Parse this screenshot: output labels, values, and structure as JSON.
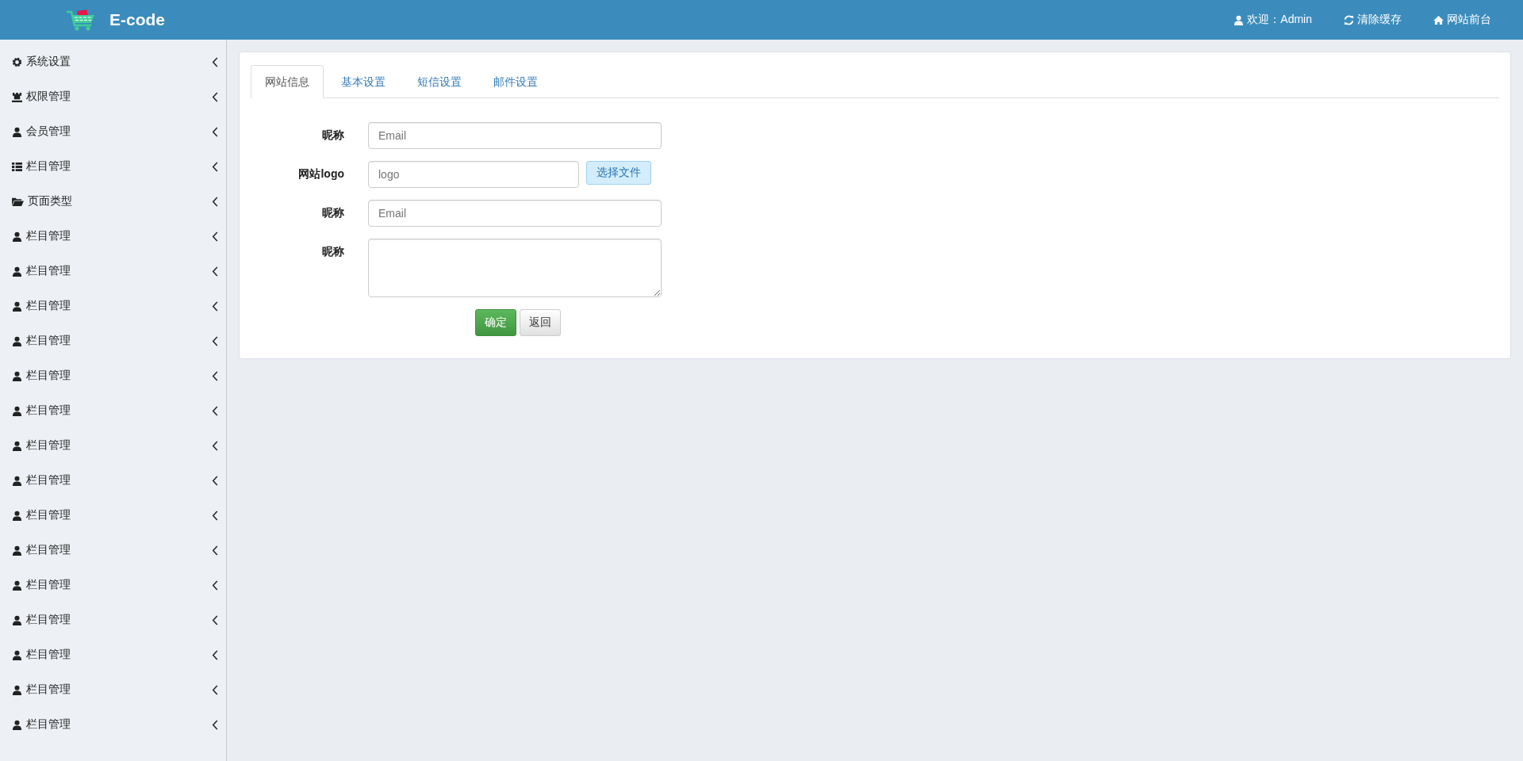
{
  "header": {
    "brand": "E-code",
    "links": [
      {
        "kind": "user",
        "label": "欢迎：Admin"
      },
      {
        "kind": "refresh",
        "label": "清除缓存"
      },
      {
        "kind": "home",
        "label": "网站前台"
      }
    ]
  },
  "sidebar": {
    "items": [
      {
        "kind": "gear",
        "label": "系统设置"
      },
      {
        "kind": "rook",
        "label": "权限管理"
      },
      {
        "kind": "user",
        "label": "会员管理"
      },
      {
        "kind": "list",
        "label": "栏目管理"
      },
      {
        "kind": "folder",
        "label": "页面类型"
      },
      {
        "kind": "user",
        "label": "栏目管理"
      },
      {
        "kind": "user",
        "label": "栏目管理"
      },
      {
        "kind": "user",
        "label": "栏目管理"
      },
      {
        "kind": "user",
        "label": "栏目管理"
      },
      {
        "kind": "user",
        "label": "栏目管理"
      },
      {
        "kind": "user",
        "label": "栏目管理"
      },
      {
        "kind": "user",
        "label": "栏目管理"
      },
      {
        "kind": "user",
        "label": "栏目管理"
      },
      {
        "kind": "user",
        "label": "栏目管理"
      },
      {
        "kind": "user",
        "label": "栏目管理"
      },
      {
        "kind": "user",
        "label": "栏目管理"
      },
      {
        "kind": "user",
        "label": "栏目管理"
      },
      {
        "kind": "user",
        "label": "栏目管理"
      },
      {
        "kind": "user",
        "label": "栏目管理"
      },
      {
        "kind": "user",
        "label": "栏目管理"
      }
    ]
  },
  "tabs": [
    {
      "label": "网站信息",
      "selected": true
    },
    {
      "label": "基本设置",
      "selected": false
    },
    {
      "label": "短信设置",
      "selected": false
    },
    {
      "label": "邮件设置",
      "selected": false
    }
  ],
  "form": {
    "rows": [
      {
        "kind": "input",
        "label": "昵称",
        "placeholder": "Email"
      },
      {
        "kind": "file",
        "label": "网站logo",
        "placeholder": "logo",
        "button": "选择文件"
      },
      {
        "kind": "input",
        "label": "昵称",
        "placeholder": "Email"
      },
      {
        "kind": "textarea",
        "label": "昵称"
      }
    ],
    "submit": "确定",
    "back": "返回"
  }
}
